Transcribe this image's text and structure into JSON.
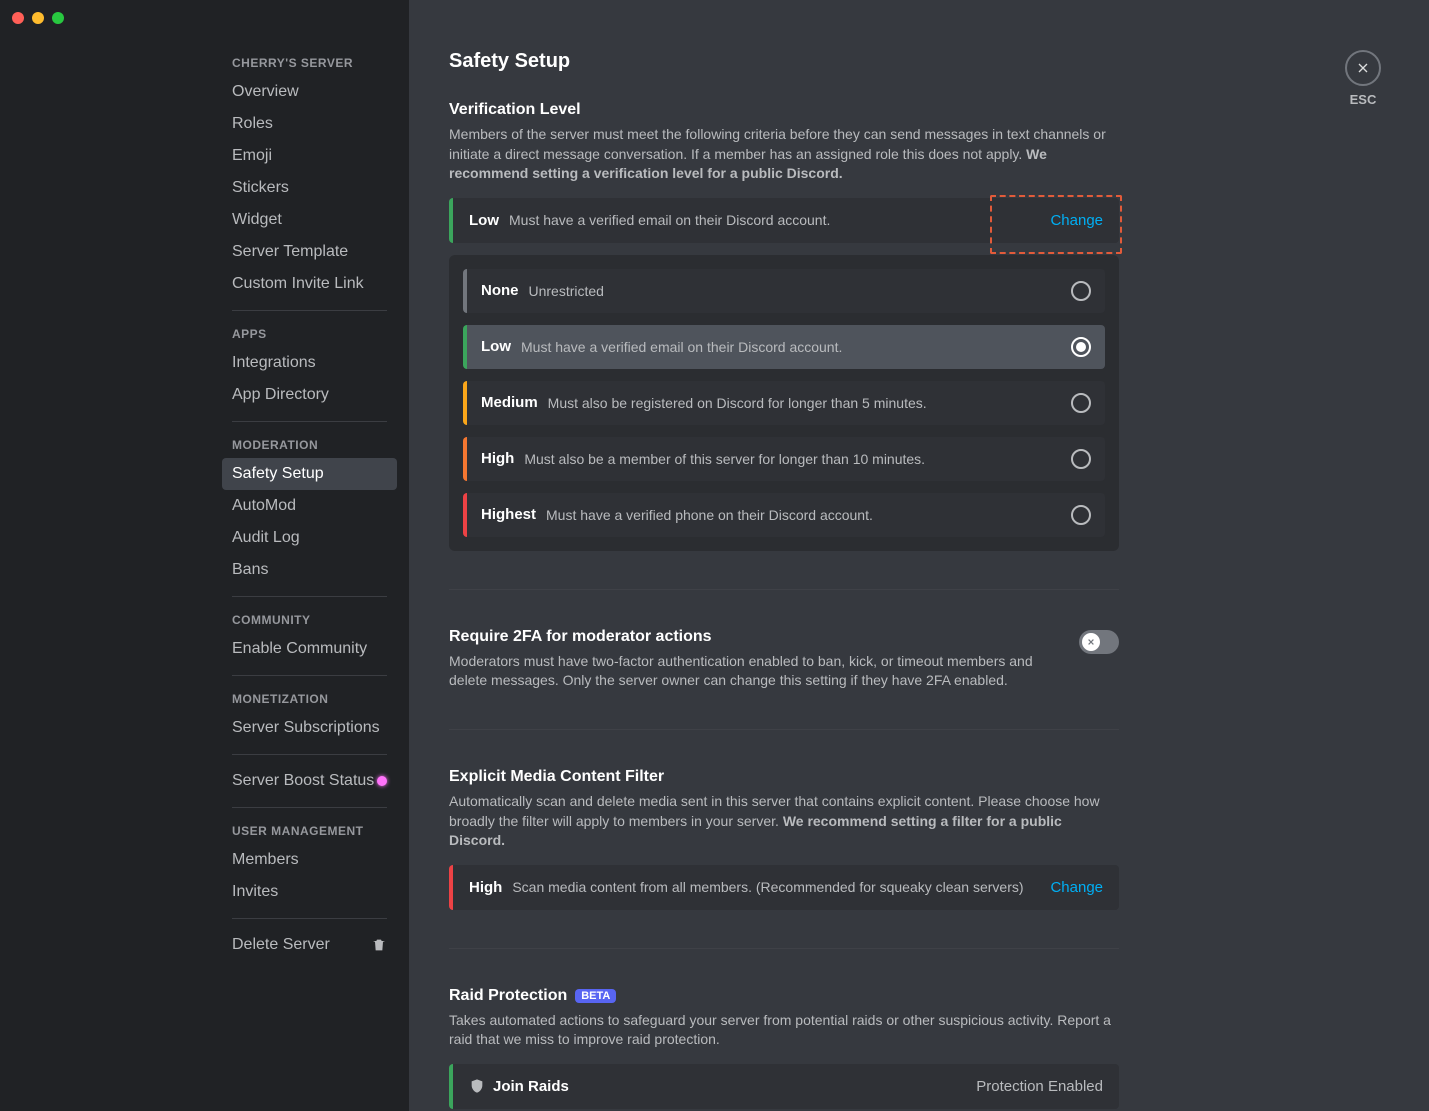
{
  "sidebar": {
    "serverName": "CHERRY'S SERVER",
    "sections": {
      "server": [
        "Overview",
        "Roles",
        "Emoji",
        "Stickers",
        "Widget",
        "Server Template",
        "Custom Invite Link"
      ],
      "appsHeading": "APPS",
      "apps": [
        "Integrations",
        "App Directory"
      ],
      "moderationHeading": "MODERATION",
      "moderation": [
        "Safety Setup",
        "AutoMod",
        "Audit Log",
        "Bans"
      ],
      "communityHeading": "COMMUNITY",
      "community": [
        "Enable Community"
      ],
      "monetizationHeading": "MONETIZATION",
      "monetization": [
        "Server Subscriptions"
      ],
      "boost": "Server Boost Status",
      "userMgmtHeading": "USER MANAGEMENT",
      "userMgmt": [
        "Members",
        "Invites"
      ],
      "delete": "Delete Server"
    }
  },
  "page": {
    "title": "Safety Setup",
    "closeLabel": "ESC"
  },
  "verification": {
    "title": "Verification Level",
    "desc": "Members of the server must meet the following criteria before they can send messages in text channels or initiate a direct message conversation. If a member has an assigned role this does not apply. ",
    "descBold": "We recommend setting a verification level for a public Discord.",
    "current": {
      "label": "Low",
      "desc": "Must have a verified email on their Discord account.",
      "change": "Change",
      "color": "#3ba55c"
    },
    "options": [
      {
        "label": "None",
        "desc": "Unrestricted",
        "color": "#72767d",
        "selected": false
      },
      {
        "label": "Low",
        "desc": "Must have a verified email on their Discord account.",
        "color": "#3ba55c",
        "selected": true
      },
      {
        "label": "Medium",
        "desc": "Must also be registered on Discord for longer than 5 minutes.",
        "color": "#faa61a",
        "selected": false
      },
      {
        "label": "High",
        "desc": "Must also be a member of this server for longer than 10 minutes.",
        "color": "#f57731",
        "selected": false
      },
      {
        "label": "Highest",
        "desc": "Must have a verified phone on their Discord account.",
        "color": "#ed4245",
        "selected": false
      }
    ]
  },
  "twoFA": {
    "title": "Require 2FA for moderator actions",
    "desc": "Moderators must have two-factor authentication enabled to ban, kick, or timeout members and delete messages. Only the server owner can change this setting if they have 2FA enabled.",
    "enabled": false
  },
  "explicit": {
    "title": "Explicit Media Content Filter",
    "desc": "Automatically scan and delete media sent in this server that contains explicit content. Please choose how broadly the filter will apply to members in your server. ",
    "descBold": "We recommend setting a filter for a public Discord.",
    "current": {
      "label": "High",
      "desc": "Scan media content from all members. (Recommended for squeaky clean servers)",
      "change": "Change",
      "color": "#ed4245"
    }
  },
  "raid": {
    "title": "Raid Protection",
    "badge": "BETA",
    "desc": "Takes automated actions to safeguard your server from potential raids or other suspicious activity. Report a raid that we miss to improve raid protection.",
    "row": {
      "label": "Join Raids",
      "status": "Protection Enabled"
    }
  }
}
